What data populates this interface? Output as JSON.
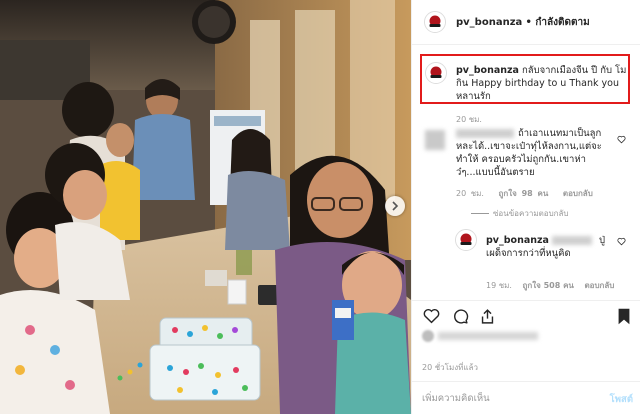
{
  "post": {
    "username": "pv_bonanza",
    "follow_status": "• กำลังติดตาม",
    "caption": {
      "username": "pv_bonanza",
      "text": "กลับจากเมืองจีน ปี กับ โม กิน Happy birthday to u Thank you หลานรัก",
      "time": "20 ชม."
    },
    "comments": [
      {
        "text": "ถ้าเอาแนทมาเป็นลูกหละได้..เขาจะเป๋าทุ่ไห้ลงกาน,แต่จะทำให้ ครอบครัวไม่ถูกกัน.เขาห่าว๋ๆ...แบบนี้อันตราย",
        "time": "20 ชม.",
        "likes": "ถูกใจ 98 คน",
        "reply_label": "ตอบกลับ",
        "toggle_replies": "ซ่อนข้อความตอบกลับ"
      }
    ],
    "reply": {
      "username": "pv_bonanza",
      "text": "ปู่ เผด็จการกว่าที่หนูคิด",
      "time": "19 ชม.",
      "likes": "ถูกใจ 508 คน",
      "reply_label": "ตอบกลับ"
    },
    "time_ago": "20 ชั่วโมงที่แล้ว",
    "add_comment": {
      "placeholder": "เพิ่มความคิดเห็น",
      "post_label": "โพสต์"
    }
  },
  "icons": {
    "like": "heart-icon",
    "comment": "comment-icon",
    "share": "share-icon",
    "save": "bookmark-icon",
    "next": "chevron-right-icon"
  },
  "colors": {
    "highlight_box": "#e21b1b",
    "muted_text": "#999999",
    "post_button": "#b2dffc"
  }
}
